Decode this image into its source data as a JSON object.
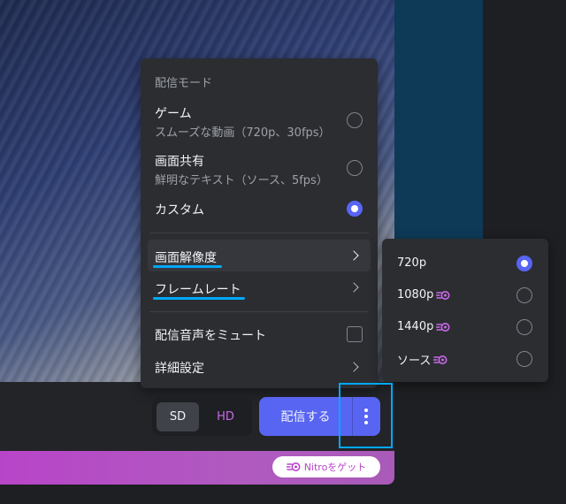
{
  "menu": {
    "header": "配信モード",
    "modes": [
      {
        "title": "ゲーム",
        "subtitle": "スムーズな動画（720p、30fps）",
        "selected": false
      },
      {
        "title": "画面共有",
        "subtitle": "鮮明なテキスト（ソース、5fps）",
        "selected": false
      },
      {
        "title": "カスタム",
        "subtitle": "",
        "selected": true
      }
    ],
    "resolution_label": "画面解像度",
    "framerate_label": "フレームレート",
    "mute_label": "配信音声をミュート",
    "advanced_label": "詳細設定"
  },
  "submenu": {
    "options": [
      {
        "label": "720p",
        "nitro": false,
        "selected": true
      },
      {
        "label": "1080p",
        "nitro": true,
        "selected": false
      },
      {
        "label": "1440p",
        "nitro": true,
        "selected": false
      },
      {
        "label": "ソース",
        "nitro": true,
        "selected": false
      }
    ]
  },
  "controls": {
    "sd_label": "SD",
    "hd_label": "HD",
    "stream_label": "配信する"
  },
  "promo": {
    "nitro_button_label": "Nitroをゲット"
  },
  "colors": {
    "accent": "#5865f2",
    "nitro_pink": "#c96ae8",
    "highlight": "#00a8fc"
  }
}
